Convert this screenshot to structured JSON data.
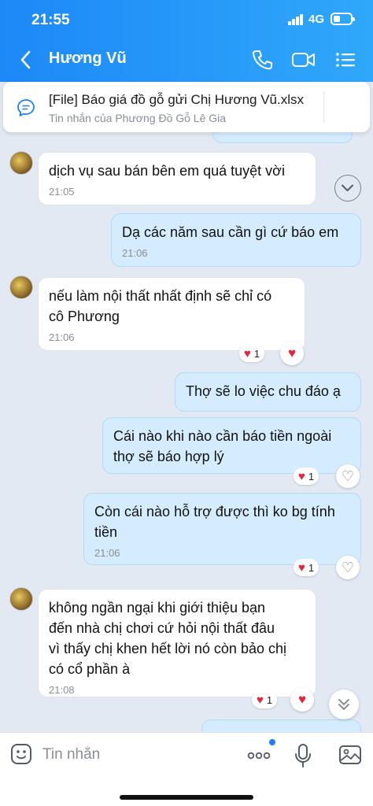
{
  "status": {
    "time": "21:55",
    "network": "4G",
    "battery_percent": 25
  },
  "header": {
    "contact_name": "Hương Vũ",
    "icons": [
      "back-icon",
      "phone-icon",
      "video-call-icon",
      "menu-list-icon"
    ]
  },
  "pinned": {
    "title": "[File] Báo giá đồ gỗ gửi Chị Hương Vũ.xlsx",
    "subtitle": "Tin nhắn của Phương Đồ Gỗ Lê Gia",
    "icons": [
      "chat-bubble-icon",
      "chevron-down-icon"
    ]
  },
  "messages": [
    {
      "side": "in",
      "text": "dịch vụ sau bán bên em quá tuyệt vời",
      "time": "21:05"
    },
    {
      "side": "out",
      "text": "Dạ các năm sau cần gì cứ báo em",
      "time": "21:06"
    },
    {
      "side": "in",
      "text": "nếu làm nội thất nhất định sẽ chỉ có\ncô Phương",
      "time": "21:06",
      "reaction_count": "1"
    },
    {
      "side": "out",
      "text": "Thợ sẽ lo việc chu đáo ạ"
    },
    {
      "side": "out",
      "text": "Cái nào khi nào cần báo tiền ngoài\nthợ sẽ báo hợp lý",
      "reaction_count": "1"
    },
    {
      "side": "out",
      "text": "Còn cái nào hỗ trợ được thì ko bg tính\ntiền",
      "time": "21:06",
      "reaction_count": "1"
    },
    {
      "side": "in",
      "text": "không ngần ngại khi giới thiệu bạn\nđến nhà chị chơi cứ hỏi nội thất đâu\nvì thấy chị khen hết lời nó còn bảo chị\ncó cổ phần à",
      "time": "21:08",
      "reaction_count": "1"
    }
  ],
  "composer": {
    "placeholder": "Tin nhắn",
    "icons": [
      "emoji-icon",
      "more-icon",
      "microphone-icon",
      "image-icon"
    ]
  },
  "colors": {
    "header_start": "#1d88f7",
    "header_end": "#2fa8fb",
    "outgoing_bubble": "#d4ecfe",
    "incoming_bubble": "#ffffff",
    "heart": "#e5243b"
  }
}
